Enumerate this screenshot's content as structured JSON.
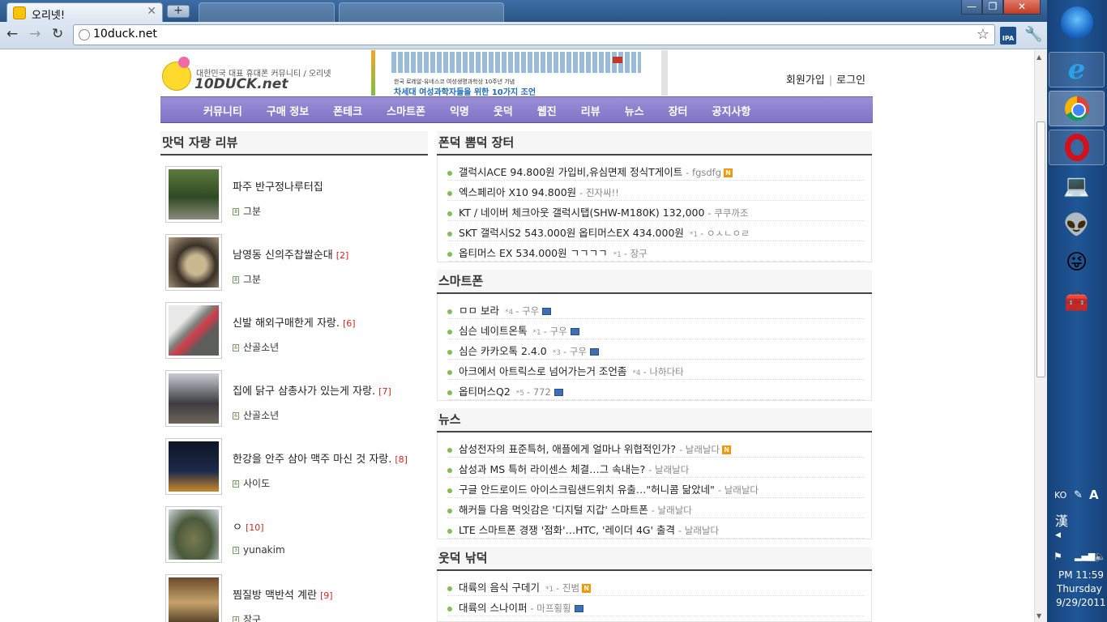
{
  "browser": {
    "tabs": [
      {
        "title": "오리넷!"
      },
      {
        "title": "",
        "blurred": true
      },
      {
        "title": "",
        "blurred": true
      }
    ],
    "new_tab_label": "+",
    "url": "10duck.net",
    "window_controls": {
      "minimize": "—",
      "restore": "❐",
      "close": "✕"
    }
  },
  "site": {
    "logo": {
      "tagline": "대한민국 대표 휴대폰 커뮤니티 / 오리넷",
      "name": "10DUCK.net"
    },
    "banner": {
      "line1": "한국 로레알-유네스코 여성생명과학상 10주년 기념",
      "line2": "차세대 여성과학자들을 위한 10가지 조언"
    },
    "auth": {
      "signup": "회원가입",
      "login": "로그인"
    },
    "nav": [
      "커뮤니티",
      "구매 정보",
      "폰테크",
      "스마트폰",
      "익명",
      "웃덕",
      "웹진",
      "리뷰",
      "뉴스",
      "장터",
      "공지사항"
    ]
  },
  "reviews": {
    "title": "맛덕 자랑 리뷰",
    "items": [
      {
        "title": "파주 반구정나루터집",
        "count": "",
        "author": "그분",
        "level": "8"
      },
      {
        "title": "남영동 신의주찹쌀순대",
        "count": "[2]",
        "author": "그분",
        "level": "8"
      },
      {
        "title": "신발 해외구매한게 자랑.",
        "count": "[6]",
        "author": "산골소년",
        "level": "6"
      },
      {
        "title": "집에 닭구 삼총사가 있는게 자랑.",
        "count": "[7]",
        "author": "산골소년",
        "level": "6"
      },
      {
        "title": "한강을 안주 삼아 맥주 마신 것 자랑.",
        "count": "[8]",
        "author": "사이도",
        "level": "6"
      },
      {
        "title": "ㅇ",
        "count": "[10]",
        "author": "yunakim",
        "level": "3"
      },
      {
        "title": "찜질방 맥반석 계란",
        "count": "[9]",
        "author": "장구",
        "level": "4"
      }
    ]
  },
  "market": {
    "title": "폰덕 뽐덕 장터",
    "posts": [
      {
        "title": "갤럭시ACE 94.800원 가입비,유심면제 정식T게이트",
        "comments": "",
        "author": "- fgsdfg",
        "new": true,
        "img": false
      },
      {
        "title": "엑스페리아 X10 94.800원",
        "comments": "",
        "author": "- 진자싸!!",
        "new": false,
        "img": false
      },
      {
        "title": "KT / 네이버 체크아웃 갤럭시탭(SHW-M180K) 132,000",
        "comments": "",
        "author": "- 쿠쿠까조",
        "new": false,
        "img": false
      },
      {
        "title": "SKT 갤럭시S2 543.000원 옵티머스EX 434.000원",
        "comments": "*1",
        "author": "- ㅇㅅㄴㅇㄹ",
        "new": false,
        "img": false
      },
      {
        "title": "옵티머스 EX 534.000원 ㄱㄱㄱㄱ",
        "comments": "*1",
        "author": "- 장구",
        "new": false,
        "img": false
      }
    ]
  },
  "smartphone": {
    "title": "스마트폰",
    "posts": [
      {
        "title": "ㅁㅁ 보라",
        "comments": "*4",
        "author": "- 구우",
        "new": false,
        "img": true
      },
      {
        "title": "심슨 네이트온톡",
        "comments": "*1",
        "author": "- 구우",
        "new": false,
        "img": true
      },
      {
        "title": "심슨 카카오톡 2.4.0",
        "comments": "*3",
        "author": "- 구우",
        "new": false,
        "img": true
      },
      {
        "title": "아크에서 아트릭스로 넘어가는거 조언좀",
        "comments": "*4",
        "author": "- 나하다타",
        "new": false,
        "img": false
      },
      {
        "title": "옵티머스Q2",
        "comments": "*5",
        "author": "- 772",
        "new": false,
        "img": true
      }
    ]
  },
  "news": {
    "title": "뉴스",
    "posts": [
      {
        "title": "삼성전자의 표준특허, 애플에게 얼마나 위협적인가?",
        "comments": "",
        "author": "- 날래날다",
        "new": true,
        "img": false
      },
      {
        "title": "삼성과 MS 특허 라이센스 체결…그 속내는?",
        "comments": "",
        "author": "- 날래날다",
        "new": false,
        "img": false
      },
      {
        "title": "구글 안드로이드 아이스크림샌드위치 유출…\"허니콤 닮았네\"",
        "comments": "",
        "author": "- 날래날다",
        "new": false,
        "img": false
      },
      {
        "title": "해커들 다음 먹잇감은 '디지털 지갑' 스마트폰",
        "comments": "",
        "author": "- 날래날다",
        "new": false,
        "img": false
      },
      {
        "title": "LTE 스마트폰 경쟁 '점화'…HTC, '레이더 4G' 출격",
        "comments": "",
        "author": "- 날래날다",
        "new": false,
        "img": false
      }
    ]
  },
  "humor": {
    "title": "웃덕 낚덕",
    "posts": [
      {
        "title": "대륙의 음식 구데기",
        "comments": "*1",
        "author": "- 진범",
        "new": true,
        "img": false
      },
      {
        "title": "대륙의 스나이퍼",
        "comments": "",
        "author": "- 마프횡횡",
        "new": false,
        "img": true
      }
    ]
  },
  "taskbar": {
    "language": "KO",
    "ime": "漢",
    "time": "PM 11:59",
    "day": "Thursday",
    "date": "9/29/2011"
  },
  "colors": {
    "nav_bg": "#8a7ecf",
    "bullet": "#7cbf53",
    "count_red": "#d2261d",
    "new_badge": "#f39800"
  }
}
